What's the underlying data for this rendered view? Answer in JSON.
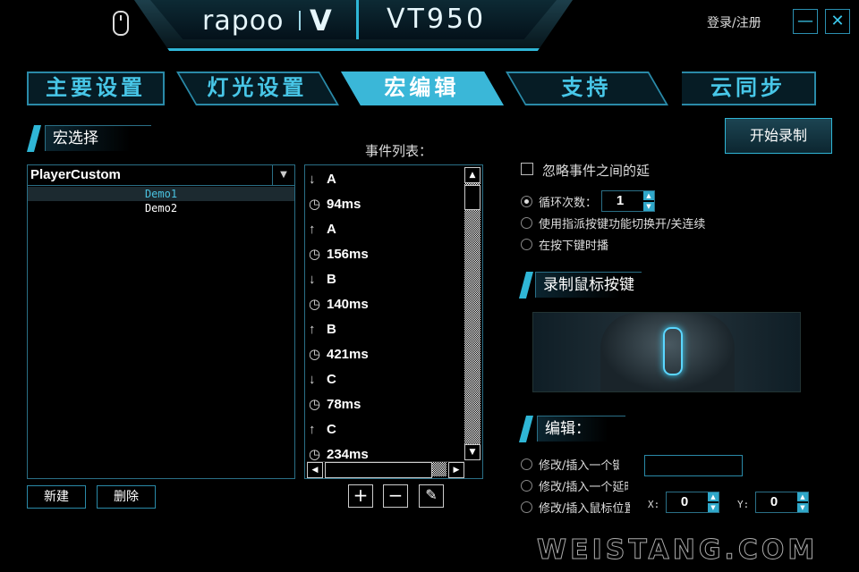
{
  "header": {
    "brand": "rapoo",
    "brand_mark": "V",
    "model": "VT950",
    "login": "登录/注册",
    "minimize": "—",
    "close": "✕"
  },
  "tabs": [
    {
      "label": "主要设置",
      "active": false
    },
    {
      "label": "灯光设置",
      "active": false
    },
    {
      "label": "宏编辑",
      "active": true
    },
    {
      "label": "支持",
      "active": false
    },
    {
      "label": "云同步",
      "active": false
    }
  ],
  "macro_select": {
    "title": "宏选择",
    "dropdown_value": "PlayerCustom",
    "items": [
      {
        "label": "Demo1",
        "selected": true
      },
      {
        "label": "Demo2",
        "selected": false
      }
    ],
    "new_button": "新建",
    "delete_button": "删除"
  },
  "events": {
    "title": "事件列表：",
    "items": [
      {
        "icon": "↓",
        "text": "A"
      },
      {
        "icon": "◷",
        "text": "94ms"
      },
      {
        "icon": "↑",
        "text": "A"
      },
      {
        "icon": "◷",
        "text": "156ms"
      },
      {
        "icon": "↓",
        "text": "B"
      },
      {
        "icon": "◷",
        "text": "140ms"
      },
      {
        "icon": "↑",
        "text": "B"
      },
      {
        "icon": "◷",
        "text": "421ms"
      },
      {
        "icon": "↓",
        "text": "C"
      },
      {
        "icon": "◷",
        "text": "78ms"
      },
      {
        "icon": "↑",
        "text": "C"
      },
      {
        "icon": "◷",
        "text": "234ms"
      }
    ],
    "tools": {
      "add": "+",
      "remove": "−",
      "edit": "✎"
    }
  },
  "record": {
    "start_button": "开始录制",
    "ignore_delay": "忽略事件之间的延",
    "loop_label": "循环次数：",
    "loop_count": "1",
    "toggle_option": "使用指派按键功能切换开/关连续",
    "hold_option": "在按下键时播",
    "mouse_section": "录制鼠标按键"
  },
  "edit": {
    "title": "编辑：",
    "opt_key": "修改/插入一个键",
    "opt_delay": "修改/插入一个延时",
    "opt_mouse": "修改/插入鼠标位置",
    "x_label": "X:",
    "x_value": "0",
    "y_label": "Y:",
    "y_value": "0"
  },
  "watermark": "WEISTANG.COM",
  "colors": {
    "accent": "#2fb6d6",
    "active_tab": "#3ab7d8"
  }
}
